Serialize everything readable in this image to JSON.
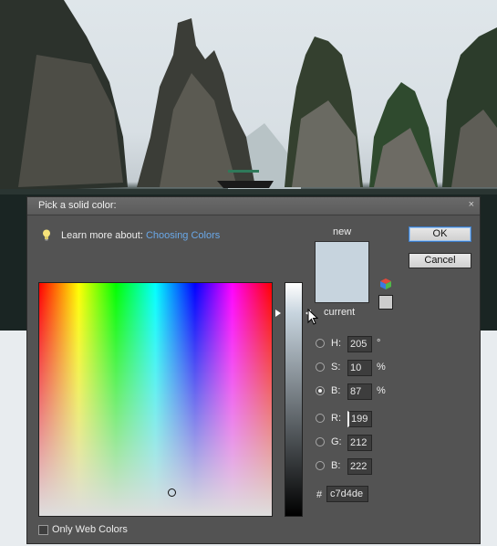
{
  "dialog": {
    "title": "Pick a solid color:",
    "close_glyph": "×",
    "learn_prefix": "Learn more about:",
    "learn_link": "Choosing Colors",
    "ok_label": "OK",
    "cancel_label": "Cancel",
    "new_label": "new",
    "current_label": "current",
    "new_color": "#c7d4de",
    "websafe_color": "#cccccc",
    "fields": {
      "h": {
        "label": "H:",
        "value": "205",
        "unit": "°",
        "selected": false
      },
      "s": {
        "label": "S:",
        "value": "10",
        "unit": "%",
        "selected": false
      },
      "b": {
        "label": "B:",
        "value": "87",
        "unit": "%",
        "selected": true
      },
      "r": {
        "label": "R:",
        "value": "199",
        "selected": false
      },
      "g": {
        "label": "G:",
        "value": "212",
        "selected": false
      },
      "bl": {
        "label": "B:",
        "value": "222",
        "selected": false
      }
    },
    "hash_label": "#",
    "hex_value": "c7d4de",
    "web_colors_label": "Only Web Colors",
    "web_colors_checked": false
  },
  "icons": [
    "lightbulb-icon",
    "close-icon",
    "color-cube-icon",
    "mouse-cursor-icon"
  ]
}
